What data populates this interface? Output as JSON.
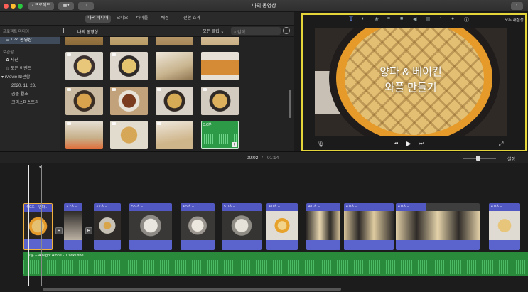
{
  "window": {
    "title": "나의 동영상"
  },
  "toolbar": {
    "back_label": "프로젝트",
    "share_icon": "share-icon"
  },
  "tabs": [
    "나의 미디어",
    "오디오",
    "타이틀",
    "배경",
    "전환 효과"
  ],
  "sidebar": {
    "project_media_heading": "프로젝트 미디어",
    "project_item": "나의 동영상",
    "library_heading": "보관함",
    "library_items": [
      "사진",
      "모든 이벤트"
    ],
    "imovie_library": "iMovie 보관함",
    "events": [
      "2020. 11. 23.",
      "곰돌 월초",
      "크리스마스트리"
    ]
  },
  "browser": {
    "title": "나의 동영상",
    "filter": "모든 클립",
    "search_placeholder": "검색",
    "audio_thumb_duration": "3.6분"
  },
  "viewer": {
    "reset_all": "모두 재설정",
    "overlay_title_line1": "양파 & 베이컨",
    "overlay_title_line2": "와플 만들기"
  },
  "timeline": {
    "current_time": "00:02",
    "separator": "/",
    "total_time": "01:14",
    "settings_label": "설정",
    "zoom_level": 0.45,
    "clips": [
      {
        "label": "4.0초 – 양파..",
        "thumb": "waffle-title"
      },
      {
        "label": "2.2초 –",
        "thumb": "grater"
      },
      {
        "label": "3.7초 –",
        "thumb": "bowl-mix"
      },
      {
        "label": "5.9초 –",
        "thumb": "batter"
      },
      {
        "label": "4.5초 –",
        "thumb": "whisk"
      },
      {
        "label": "5.0초 –",
        "thumb": "whisk2"
      },
      {
        "label": "4.0초 –",
        "thumb": "iron-top"
      },
      {
        "label": "4.0초 –",
        "thumb": "iron-open"
      },
      {
        "label": "4.0초 –",
        "thumb": "iron-open2"
      },
      {
        "label": "4.0초 –",
        "thumb": "waffle-wide"
      },
      {
        "label": "4.0초 –",
        "thumb": "waffle-final"
      }
    ],
    "audio_label": "1.2분 – A Night Alone - TrackTribe"
  },
  "colors": {
    "accent_yellow": "#e4d63a",
    "clip_blue": "#5258c2",
    "audio_green": "#2a8a3c"
  }
}
